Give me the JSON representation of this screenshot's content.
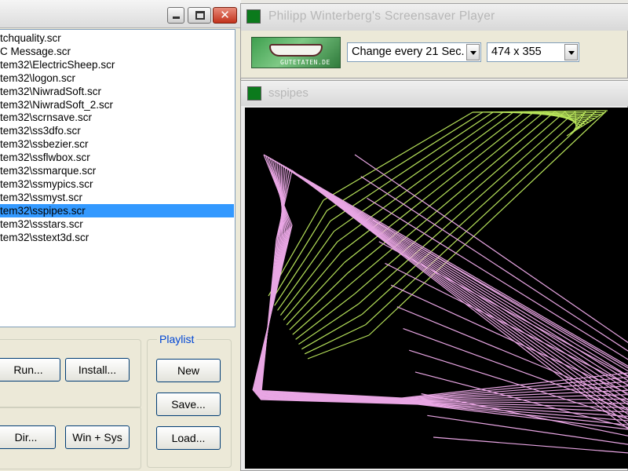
{
  "file_list": {
    "items": [
      "tchquality.scr",
      "C Message.scr",
      "tem32\\ElectricSheep.scr",
      "tem32\\logon.scr",
      "tem32\\NiwradSoft.scr",
      "tem32\\NiwradSoft_2.scr",
      "tem32\\scrnsave.scr",
      "tem32\\ss3dfo.scr",
      "tem32\\ssbezier.scr",
      "tem32\\ssflwbox.scr",
      "tem32\\ssmarque.scr",
      "tem32\\ssmypics.scr",
      "tem32\\ssmyst.scr",
      "tem32\\sspipes.scr",
      "tem32\\ssstars.scr",
      "tem32\\sstext3d.scr"
    ],
    "selected_index": 13
  },
  "buttons": {
    "run": "Run...",
    "install": "Install...",
    "dir": "Dir...",
    "win_sys": "Win + Sys",
    "new": "New",
    "save": "Save...",
    "load": "Load..."
  },
  "playlist": {
    "legend": "Playlist"
  },
  "player": {
    "title": "Philipp Winterberg's Screensaver Player",
    "logo_text": "GUTETATEN.DE",
    "interval": "Change every 21 Sec.",
    "size": "474 x 355"
  },
  "preview": {
    "title": "sspipes",
    "colors": {
      "green_lines": "#b7e35a",
      "pink_lines": "#e9a6e4"
    }
  },
  "window_controls": {
    "close_glyph": "✕"
  }
}
